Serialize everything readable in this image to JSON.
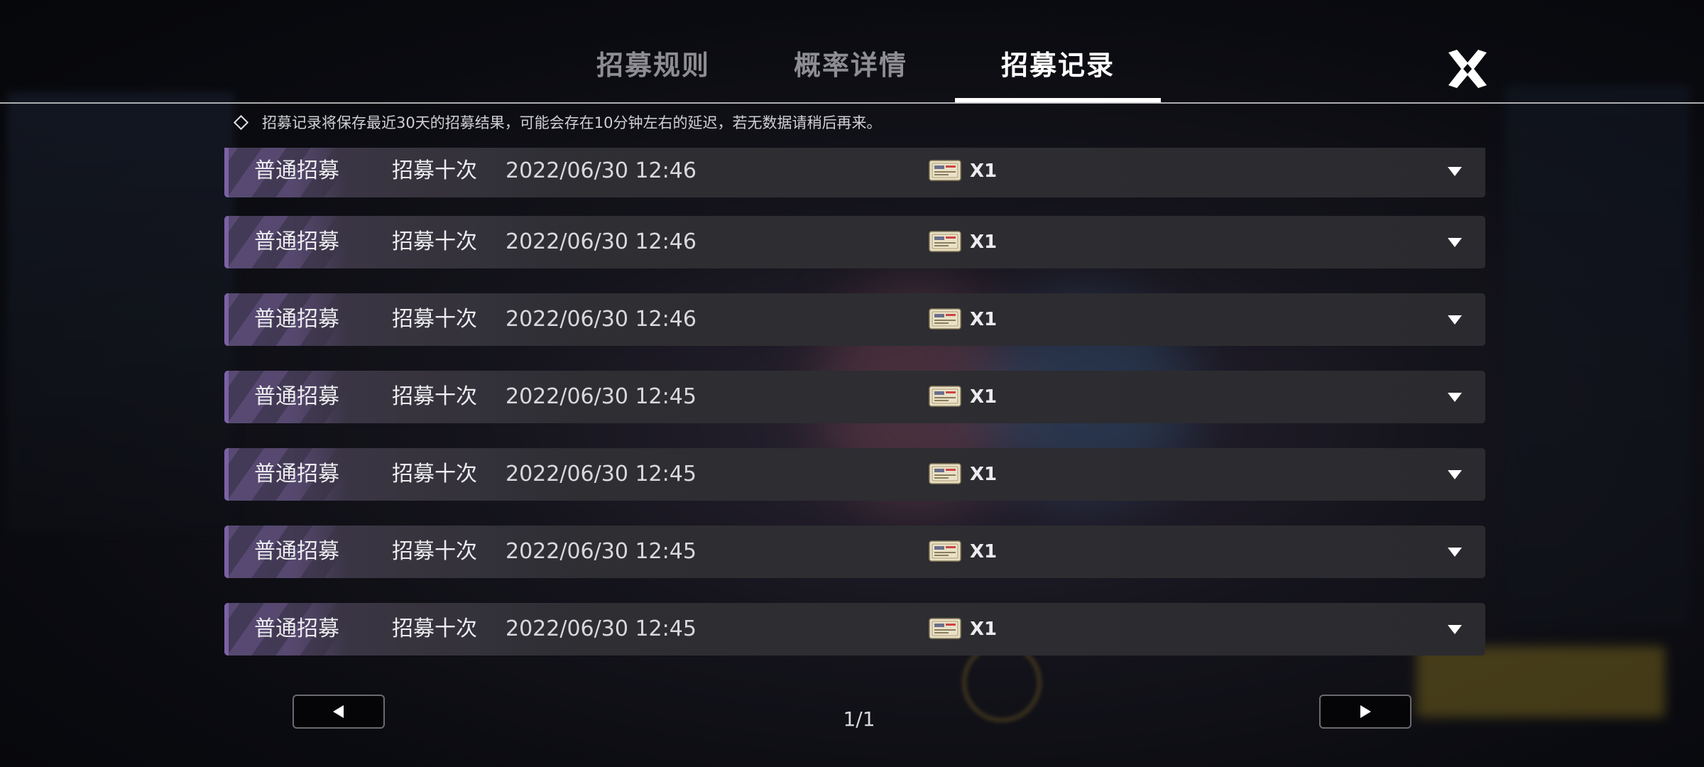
{
  "tabs": [
    {
      "label": "招募规则",
      "active": false
    },
    {
      "label": "概率详情",
      "active": false
    },
    {
      "label": "招募记录",
      "active": true
    }
  ],
  "notice": "招募记录将保存最近30天的招募结果，可能会存在10分钟左右的延迟，若无数据请稍后再来。",
  "records": [
    {
      "type": "普通招募",
      "count": "招募十次",
      "time": "2022/06/30 12:46",
      "qty": "X1"
    },
    {
      "type": "普通招募",
      "count": "招募十次",
      "time": "2022/06/30 12:46",
      "qty": "X1"
    },
    {
      "type": "普通招募",
      "count": "招募十次",
      "time": "2022/06/30 12:46",
      "qty": "X1"
    },
    {
      "type": "普通招募",
      "count": "招募十次",
      "time": "2022/06/30 12:45",
      "qty": "X1"
    },
    {
      "type": "普通招募",
      "count": "招募十次",
      "time": "2022/06/30 12:45",
      "qty": "X1"
    },
    {
      "type": "普通招募",
      "count": "招募十次",
      "time": "2022/06/30 12:45",
      "qty": "X1"
    },
    {
      "type": "普通招募",
      "count": "招募十次",
      "time": "2022/06/30 12:45",
      "qty": "X1"
    }
  ],
  "pagination": {
    "indicator": "1/1"
  },
  "icons": {
    "close": "close-x-icon",
    "expand": "triangle-down-icon",
    "ticket": "recruit-ticket-icon",
    "prev": "triangle-left-icon",
    "next": "triangle-right-icon"
  },
  "colors": {
    "accent_purple": "#7c62a6",
    "row_bg": "#2b2b2f",
    "tab_active": "#ffffff",
    "tab_inactive": "#8d8d92"
  }
}
